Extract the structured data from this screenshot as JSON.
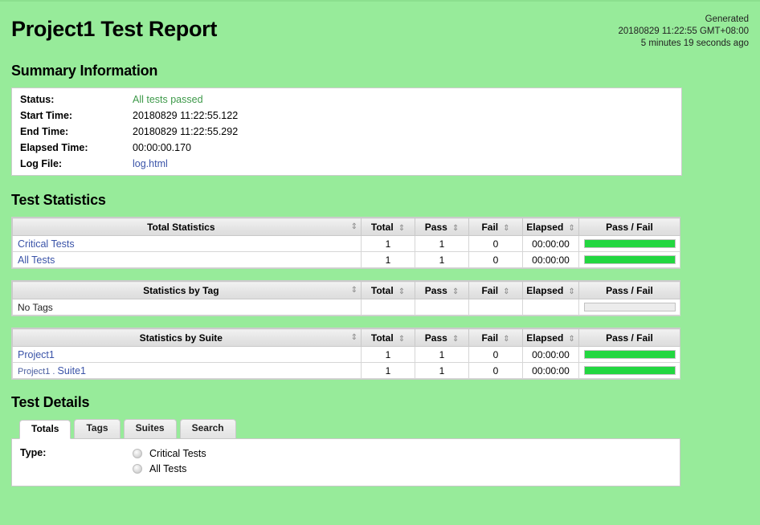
{
  "report": {
    "title": "Project1 Test Report",
    "generated_label": "Generated",
    "generated_time": "20180829 11:22:55 GMT+08:00",
    "generated_ago": "5 minutes 19 seconds ago"
  },
  "summary": {
    "heading": "Summary Information",
    "rows": [
      {
        "label": "Status:",
        "value": "All tests passed",
        "kind": "status"
      },
      {
        "label": "Start Time:",
        "value": "20180829 11:22:55.122",
        "kind": "text"
      },
      {
        "label": "End Time:",
        "value": "20180829 11:22:55.292",
        "kind": "text"
      },
      {
        "label": "Elapsed Time:",
        "value": "00:00:00.170",
        "kind": "text"
      },
      {
        "label": "Log File:",
        "value": "log.html",
        "kind": "link"
      }
    ]
  },
  "statistics": {
    "heading": "Test Statistics",
    "columns": [
      "Total",
      "Pass",
      "Fail",
      "Elapsed",
      "Pass / Fail"
    ],
    "sort_icon": "⇕",
    "tables": [
      {
        "name_header": "Total Statistics",
        "rows": [
          {
            "name": "Critical Tests",
            "total": "1",
            "pass": "1",
            "fail": "0",
            "elapsed": "00:00:00",
            "pass_pct": 100,
            "fail_pct": 0
          },
          {
            "name": "All Tests",
            "total": "1",
            "pass": "1",
            "fail": "0",
            "elapsed": "00:00:00",
            "pass_pct": 100,
            "fail_pct": 0
          }
        ]
      },
      {
        "name_header": "Statistics by Tag",
        "rows": [
          {
            "name": "No Tags",
            "total": "",
            "pass": "",
            "fail": "",
            "elapsed": "",
            "pass_pct": 0,
            "fail_pct": 0,
            "plain": true
          }
        ]
      },
      {
        "name_header": "Statistics by Suite",
        "rows": [
          {
            "name": "Project1",
            "total": "1",
            "pass": "1",
            "fail": "0",
            "elapsed": "00:00:00",
            "pass_pct": 100,
            "fail_pct": 0
          },
          {
            "name": "Project1 . Suite1",
            "parent": "Project1 . ",
            "leaf": "Suite1",
            "total": "1",
            "pass": "1",
            "fail": "0",
            "elapsed": "00:00:00",
            "pass_pct": 100,
            "fail_pct": 0
          }
        ]
      }
    ]
  },
  "details": {
    "heading": "Test Details",
    "tabs": [
      {
        "label": "Totals",
        "active": true
      },
      {
        "label": "Tags",
        "active": false
      },
      {
        "label": "Suites",
        "active": false
      },
      {
        "label": "Search",
        "active": false
      }
    ],
    "type_label": "Type:",
    "radios": [
      {
        "label": "Critical Tests",
        "checked": false
      },
      {
        "label": "All Tests",
        "checked": false
      }
    ]
  },
  "colors": {
    "background": "#97eb9a",
    "pass_bar": "#22d740",
    "fail_bar": "#e04646",
    "status_pass_text": "#3d9949",
    "link": "#3a53a8"
  }
}
